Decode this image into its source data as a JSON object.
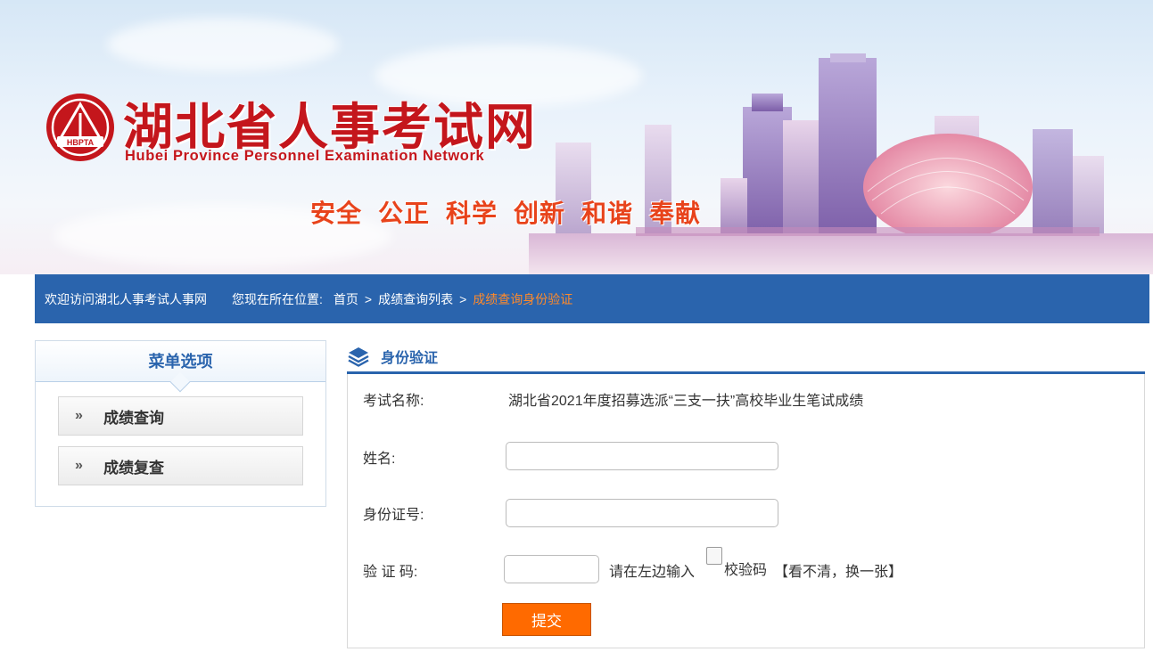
{
  "banner": {
    "site_title": "湖北省人事考试网",
    "site_subtitle": "Hubei Province Personnel Examination Network",
    "logo_text": "HBPTA",
    "slogans": [
      "安全",
      "公正",
      "科学",
      "创新",
      "和谐",
      "奉献"
    ]
  },
  "navbar": {
    "welcome": "欢迎访问湖北人事考试人事网",
    "location_label": "您现在所在位置:",
    "breadcrumbs": [
      "首页",
      "成绩查询列表",
      "成绩查询身份验证"
    ],
    "separator": ">"
  },
  "menu": {
    "title": "菜单选项",
    "items": [
      {
        "label": "成绩查询",
        "icon": "double-chevron-right-icon"
      },
      {
        "label": "成绩复查",
        "icon": "double-chevron-right-icon"
      }
    ]
  },
  "panel": {
    "title": "身份验证",
    "icon": "layers-stack-icon",
    "exam_label": "考试名称:",
    "exam_name": "湖北省2021年度招募选派“三支一扶”高校毕业生笔试成绩",
    "name_label": "姓名:",
    "name_value": "",
    "id_label": "身份证号:",
    "id_value": "",
    "captcha_label": "验 证 码:",
    "captcha_value": "",
    "captcha_hint": "请在左边输入",
    "captcha_alt": "校验码",
    "refresh_link": "【看不清，换一张】",
    "submit_label": "提交"
  },
  "colors": {
    "brand_red": "#c4161c",
    "nav_blue": "#2a64ad",
    "breadcrumb_current": "#ff8a2a",
    "submit_orange": "#ff6a00"
  }
}
